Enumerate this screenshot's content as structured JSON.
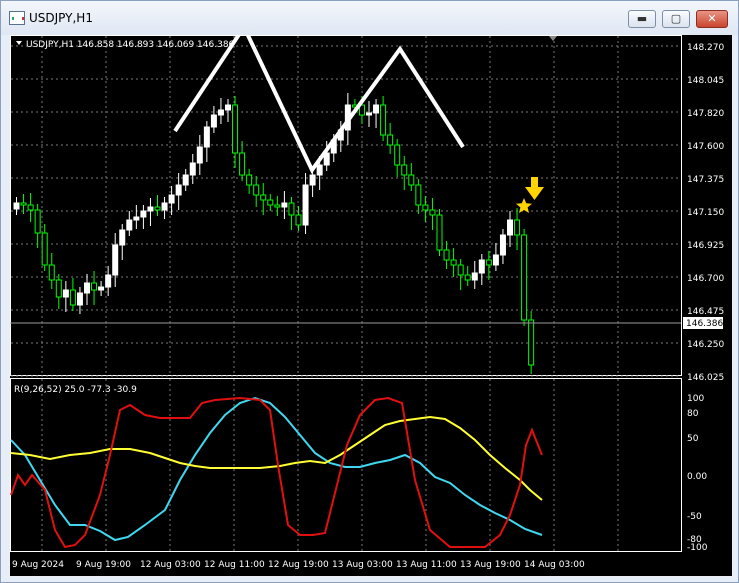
{
  "window": {
    "title": "USDJPY,H1",
    "min_glyph": "▬",
    "max_glyph": "▢",
    "close_glyph": "✕"
  },
  "main_panel": {
    "info_label": "USDJPY,H1  146.858 146.893 146.069 146.386",
    "current_price_tag": "146.386",
    "price_axis_labels": [
      "148.270",
      "148.045",
      "147.820",
      "147.600",
      "147.375",
      "147.150",
      "146.925",
      "146.700",
      "146.475",
      "146.250",
      "146.025"
    ]
  },
  "indicator_panel": {
    "info_label": "R(9,26,52) 25.0 -77.3 -30.9",
    "axis_labels": [
      "100",
      "80",
      "50",
      "0.00",
      "-50",
      "-80",
      "-100"
    ]
  },
  "time_axis": {
    "labels": [
      "9 Aug 2024",
      "9 Aug 19:00",
      "12 Aug 03:00",
      "12 Aug 11:00",
      "12 Aug 19:00",
      "13 Aug 03:00",
      "13 Aug 11:00",
      "13 Aug 19:00",
      "14 Aug 03:00"
    ]
  },
  "colors": {
    "background": "#000000",
    "grid": "#8a8a8a",
    "bull_candle": "#ffffff",
    "bear_candle": "#00ff00",
    "red_line": "#e01010",
    "yellow_line": "#ffff33",
    "cyan_line": "#40d8f0",
    "annotation_arrow": "#ffd400",
    "annotation_star": "#ffd400",
    "pattern_line": "#ffffff"
  },
  "icons": {
    "dropdown": "triangle-down-icon",
    "chart_shift": "chart-shift-marker-icon",
    "signal_arrow": "arrow-down-icon",
    "signal_star": "star-icon"
  }
}
